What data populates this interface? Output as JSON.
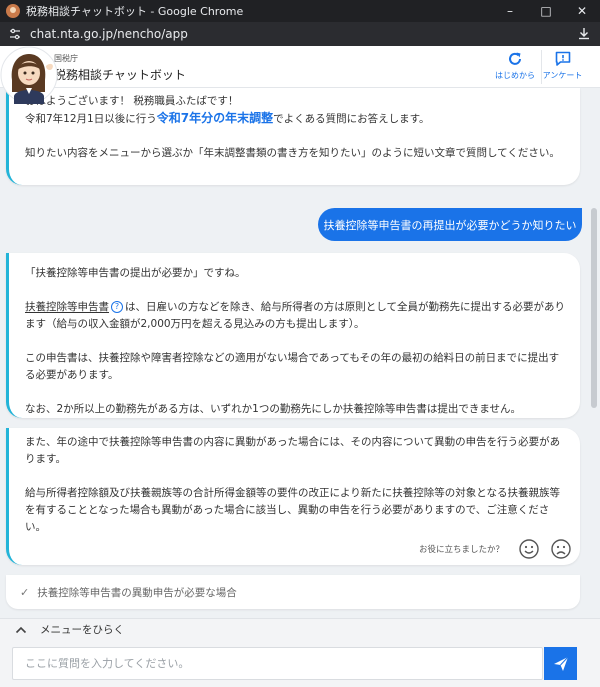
{
  "window": {
    "title": "税務相談チャットボット - Google Chrome"
  },
  "browser": {
    "url": "chat.nta.go.jp/nencho/app"
  },
  "header": {
    "org": "国税庁",
    "app_name": "税務相談チャットボット",
    "restart_label": "はじめから",
    "survey_label": "アンケート"
  },
  "messages": {
    "greeting": {
      "line1": "おはようございます！ 税務職員ふたばです！",
      "line2_pre": "令和7年12月1日以後に行う",
      "line2_highlight": "令和7年分の年末調整",
      "line2_post": "でよくある質問にお答えします。",
      "line3": "知りたい内容をメニューから選ぶか「年末調整書類の書き方を知りたい」のように短い文章で質問してください。"
    },
    "user_question": "扶養控除等申告書の再提出が必要かどうか知りたい",
    "answer1": {
      "p1": "「扶養控除等申告書の提出が必要か」ですね。",
      "term": "扶養控除等申告書",
      "p2_post": "は、日雇いの方などを除き、給与所得者の方は原則として全員が勤務先に提出する必要があります（給与の収入金額が2,000万円を超える見込みの方も提出します）。",
      "p3": "この申告書は、扶養控除や障害者控除などの適用がない場合であってもその年の最初の給料日の前日までに提出する必要があります。",
      "p4": "なお、2か所以上の勤務先がある方は、いずれか1つの勤務先にしか扶養控除等申告書は提出できません。"
    },
    "answer2": {
      "p1": "また、年の途中で扶養控除等申告書の内容に異動があった場合には、その内容について異動の申告を行う必要があります。",
      "p2": "給与所得者控除額及び扶養親族等の合計所得金額等の要件の改正により新たに扶養控除等の対象となる扶養親族等を有することとなった場合も異動があった場合に該当し、異動の申告を行う必要がありますので、ご注意ください。"
    },
    "feedback_question": "お役に立ちましたか？",
    "option": "扶養控除等申告書の異動申告が必要な場合"
  },
  "menu": {
    "toggle_label": "メニューをひらく"
  },
  "input": {
    "placeholder": "ここに質問を入力してください。"
  },
  "colors": {
    "accent": "#1a73e8",
    "bot_border": "#23b4d8",
    "chat_bg": "#eef1f4"
  }
}
